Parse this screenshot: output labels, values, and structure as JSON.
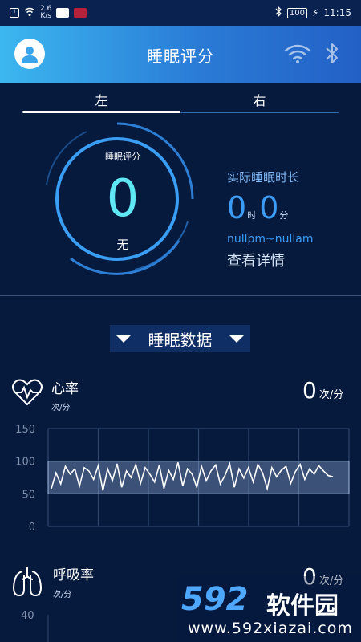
{
  "status_bar": {
    "speed_value": "2.6",
    "speed_unit": "K/s",
    "battery": "100",
    "time": "11:15"
  },
  "header": {
    "title": "睡眠评分",
    "icons": [
      "avatar-icon",
      "wifi-icon",
      "bluetooth-icon"
    ]
  },
  "tabs": [
    {
      "label": "左",
      "active": true
    },
    {
      "label": "右",
      "active": false
    }
  ],
  "score": {
    "label": "睡眠评分",
    "value": "0",
    "grade": "无"
  },
  "duration": {
    "title": "实际睡眠时长",
    "hours": "0",
    "hours_unit": "时",
    "minutes": "0",
    "minutes_unit": "分",
    "range": "nullpm~nullam",
    "details_link": "查看详情"
  },
  "section": {
    "title": "睡眠数据"
  },
  "heart_rate": {
    "name": "心率",
    "unit_small": "次/分",
    "value": "0",
    "unit": "次/分"
  },
  "heart_chart": {
    "y_ticks": [
      "150",
      "100",
      "50",
      "0"
    ]
  },
  "chart_data": {
    "type": "line",
    "title": "",
    "xlabel": "",
    "ylabel": "",
    "ylim": [
      0,
      150
    ],
    "y_ticks": [
      150,
      100,
      50,
      0
    ],
    "band": [
      50,
      100
    ],
    "series": [
      {
        "values": [
          58,
          82,
          65,
          92,
          80,
          88,
          62,
          90,
          85,
          72,
          93,
          55,
          88,
          70,
          96,
          60,
          85,
          75,
          95,
          66,
          90,
          80,
          68,
          94,
          58,
          86,
          72,
          98,
          62,
          88,
          80,
          60,
          92,
          70,
          85,
          94,
          65,
          78,
          96,
          60,
          88,
          74,
          90,
          68,
          95,
          82,
          58,
          90,
          76,
          86,
          92,
          66,
          84,
          95,
          72,
          88,
          80,
          93,
          85,
          78,
          76
        ]
      }
    ],
    "grid": true
  },
  "respiration": {
    "name": "呼吸率",
    "unit_small": "次/分",
    "value": "0",
    "unit": "次/分",
    "y_tick_top": "40"
  },
  "watermark": {
    "brand_num": "592",
    "brand_cn": "软件园",
    "url": "www.592xiazai.com"
  }
}
